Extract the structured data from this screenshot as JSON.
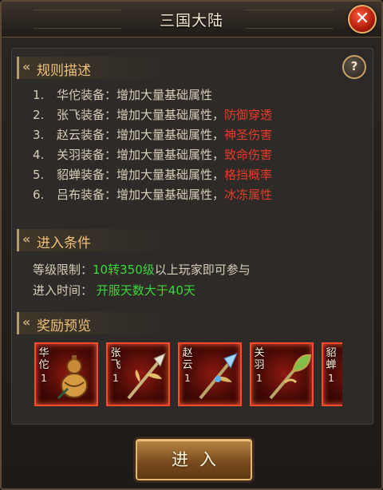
{
  "window": {
    "title": "三国大陆"
  },
  "rules": {
    "header": "规则描述",
    "items": [
      {
        "num": "1.",
        "text": "华佗装备：增加大量基础属性",
        "attr": ""
      },
      {
        "num": "2.",
        "text": "张飞装备：增加大量基础属性，",
        "attr": "防御穿透"
      },
      {
        "num": "3.",
        "text": "赵云装备：增加大量基础属性，",
        "attr": "神圣伤害"
      },
      {
        "num": "4.",
        "text": "关羽装备：增加大量基础属性，",
        "attr": "致命伤害"
      },
      {
        "num": "5.",
        "text": "貂蝉装备：增加大量基础属性，",
        "attr": "格挡概率"
      },
      {
        "num": "6.",
        "text": "吕布装备：增加大量基础属性，",
        "attr": "冰冻属性"
      }
    ]
  },
  "conditions": {
    "header": "进入条件",
    "level_label": "等级限制：",
    "level_value": "10转350级",
    "level_suffix": "以上玩家即可参与",
    "time_label": "进入时间：",
    "time_value": "开服天数大于40天"
  },
  "rewards": {
    "header": "奖励预览",
    "items": [
      {
        "name": "华佗",
        "level": "1",
        "icon": "gourd-icon"
      },
      {
        "name": "张飞",
        "level": "1",
        "icon": "spear-icon"
      },
      {
        "name": "赵云",
        "level": "1",
        "icon": "spear-icon"
      },
      {
        "name": "关羽",
        "level": "1",
        "icon": "glaive-icon"
      },
      {
        "name": "貂蝉",
        "level": "1",
        "icon": "weapon-icon"
      }
    ]
  },
  "enter_button": "进入",
  "help_button": "?",
  "close_button": "✕",
  "colors": {
    "accent_gold": "#f0c078",
    "attr_red": "#ea3a2a",
    "value_green": "#3bd83b",
    "card_border": "#ff4b2c"
  }
}
